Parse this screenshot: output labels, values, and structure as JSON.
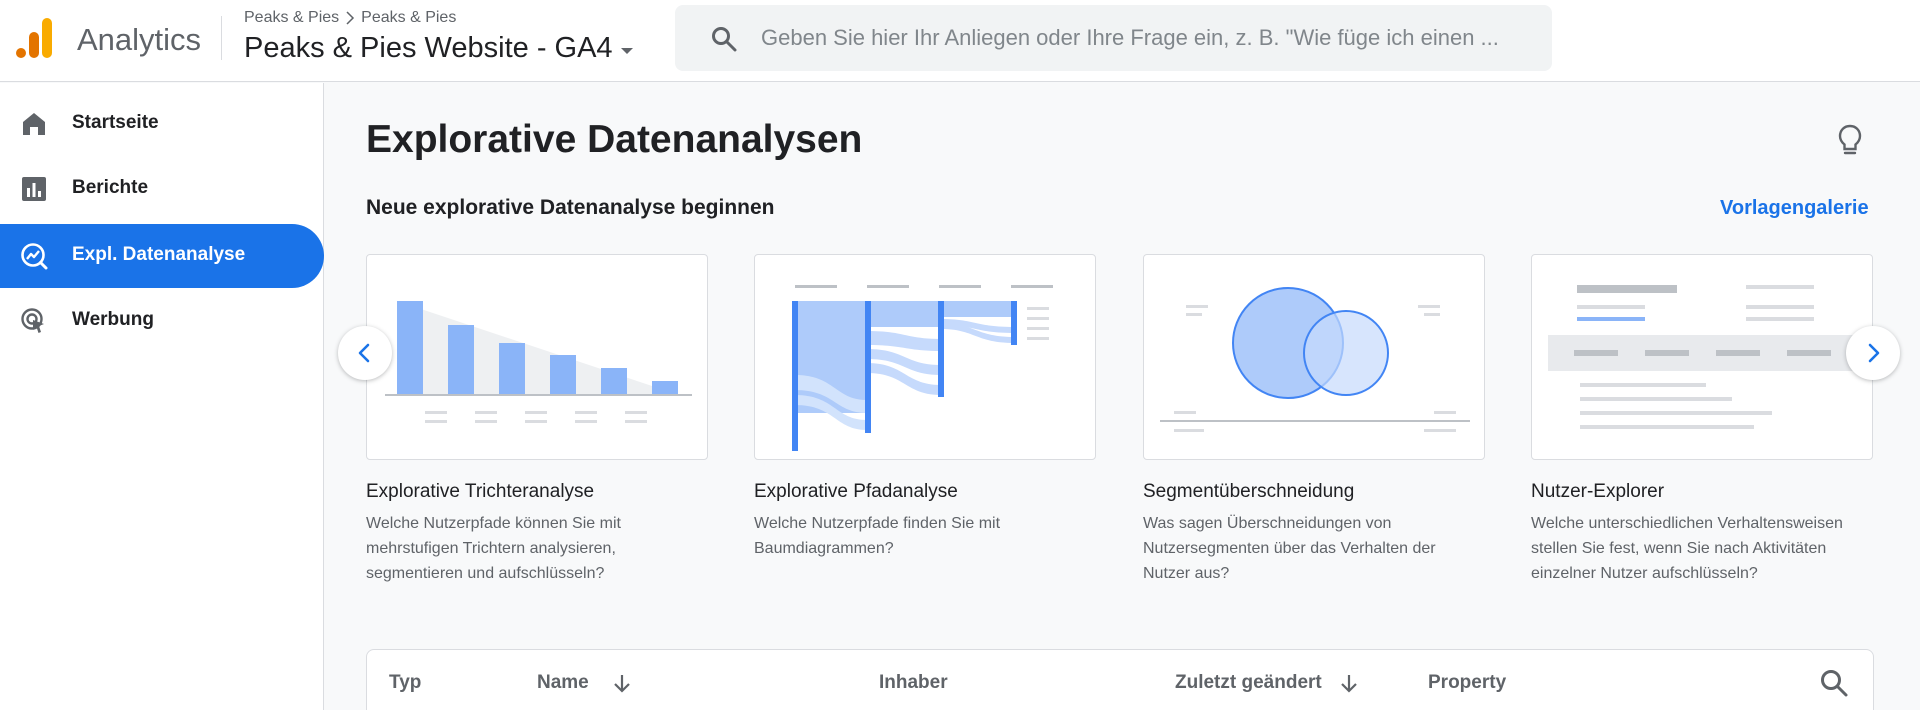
{
  "header": {
    "brand": "Analytics",
    "breadcrumb": [
      "Peaks & Pies",
      "Peaks & Pies"
    ],
    "property_title": "Peaks & Pies Website - GA4",
    "search_placeholder": "Geben Sie hier Ihr Anliegen oder Ihre Frage ein, z. B. \"Wie füge ich einen ...",
    "logo_colors": [
      "#f9ab00",
      "#e37400"
    ]
  },
  "sidebar": {
    "items": [
      {
        "label": "Startseite",
        "icon": "home-icon",
        "active": false
      },
      {
        "label": "Berichte",
        "icon": "reports-icon",
        "active": false
      },
      {
        "label": "Expl. Datenanalyse",
        "icon": "explore-icon",
        "active": true
      },
      {
        "label": "Werbung",
        "icon": "advertising-icon",
        "active": false
      }
    ],
    "active_color": "#1a73e8"
  },
  "main": {
    "page_title": "Explorative Datenanalysen",
    "section_title": "Neue explorative Datenanalyse beginnen",
    "gallery_link": "Vorlagengalerie",
    "cards": [
      {
        "title": "Explorative Trichteranalyse",
        "description": "Welche Nutzerpfade können Sie mit mehrstufigen Trichtern analysieren, segmentieren und aufschlüsseln?"
      },
      {
        "title": "Explorative Pfadanalyse",
        "description": "Welche Nutzerpfade finden Sie mit Baumdiagrammen?"
      },
      {
        "title": "Segmentüberschneidung",
        "description": "Was sagen Überschneidungen von Nutzersegmenten über das Verhalten der Nutzer aus?"
      },
      {
        "title": "Nutzer-Explorer",
        "description": "Welche unterschiedlichen Verhaltensweisen stellen Sie fest, wenn Sie nach Aktivitäten einzelner Nutzer aufschlüsseln?"
      }
    ],
    "table": {
      "columns": [
        "Typ",
        "Name",
        "Inhaber",
        "Zuletzt geändert",
        "Property"
      ]
    }
  }
}
